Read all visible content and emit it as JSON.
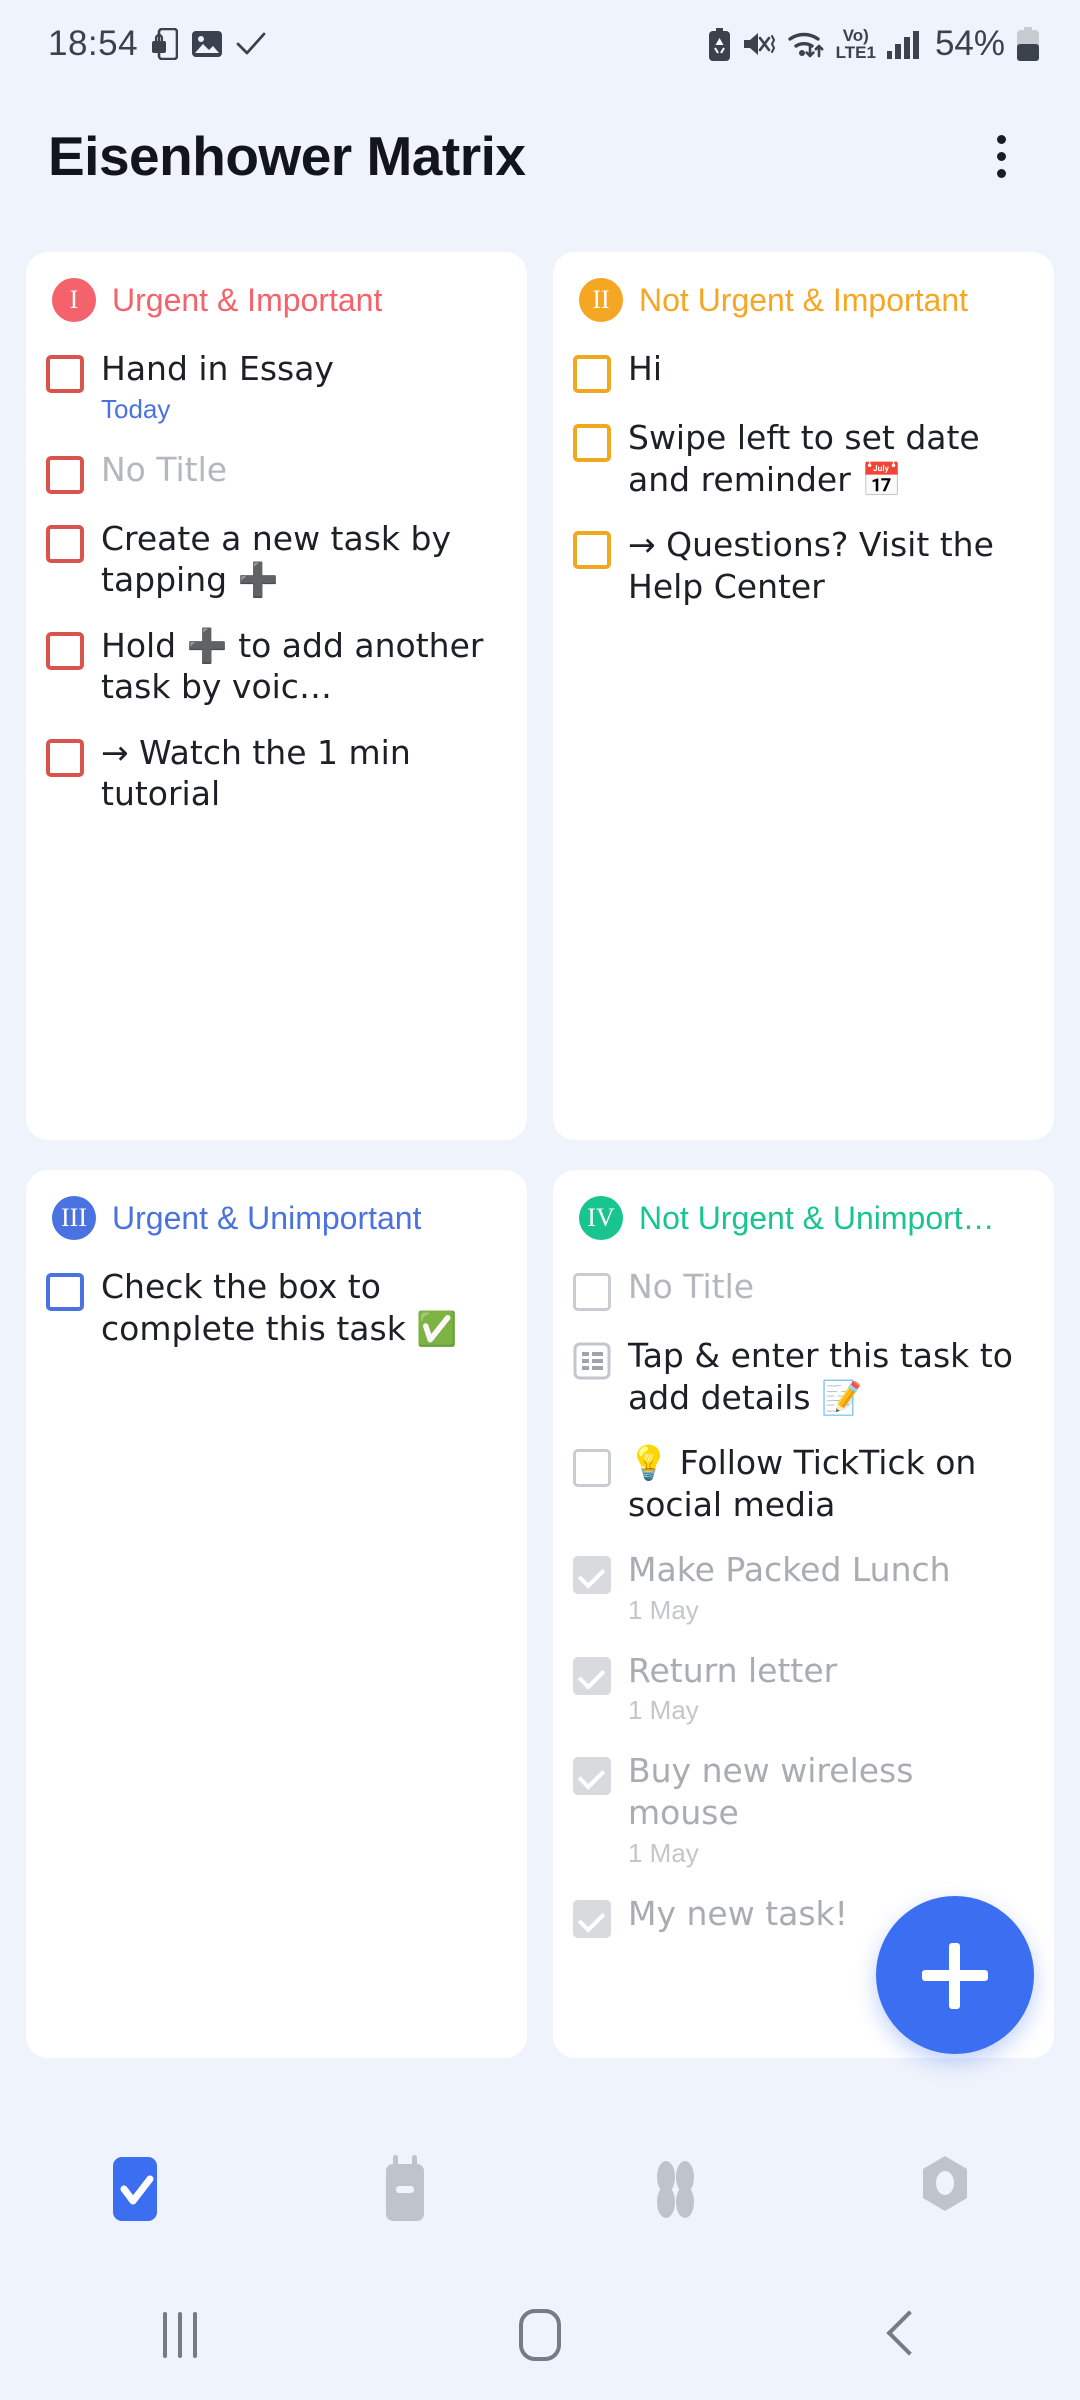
{
  "statusbar": {
    "time": "18:54",
    "battery_percent": "54%",
    "left_icons": [
      "sim-lock-icon",
      "photo-icon",
      "check-icon"
    ],
    "right_icons": [
      "battery-saver-icon",
      "mute-vibrate-icon",
      "wifi-icon",
      "volte-lte1-icon",
      "signal-bars-icon"
    ],
    "network_label_top": "Vo)",
    "network_label_bottom": "LTE1"
  },
  "header": {
    "title": "Eisenhower Matrix",
    "overflow_menu": "more-options"
  },
  "colors": {
    "background": "#eff3fb",
    "card": "#ffffff",
    "q1": "#f4626b",
    "q2": "#f5a623",
    "q3": "#4a72e0",
    "q4": "#18c58e",
    "accent": "#3b6ef0",
    "date_blue": "#4a72e0",
    "muted": "#b4b7bd"
  },
  "quadrants": [
    {
      "roman": "I",
      "title": "Urgent & Important",
      "color": "#f4626b",
      "box_style": "red",
      "tasks": [
        {
          "text": "Hand in Essay",
          "date": "Today",
          "date_style": "blue",
          "state": "open",
          "box": "red"
        },
        {
          "text": "No Title",
          "state": "placeholder",
          "box": "red"
        },
        {
          "text": "Create a new task by tapping ➕",
          "state": "open",
          "box": "red"
        },
        {
          "text": "Hold ➕ to add another task by voic…",
          "state": "open",
          "box": "red"
        },
        {
          "text": "→  Watch the 1 min tutorial",
          "state": "open",
          "box": "red"
        }
      ]
    },
    {
      "roman": "II",
      "title": "Not Urgent & Important",
      "color": "#f5a623",
      "box_style": "amber",
      "tasks": [
        {
          "text": "Hi",
          "state": "open",
          "box": "amber"
        },
        {
          "text": "Swipe left to set date and reminder 📅",
          "state": "open",
          "box": "amber"
        },
        {
          "text": "→  Questions? Visit the Help Center",
          "state": "open",
          "box": "amber"
        }
      ]
    },
    {
      "roman": "III",
      "title": "Urgent & Unimportant",
      "color": "#4a72e0",
      "box_style": "blue",
      "tasks": [
        {
          "text": "Check the box to complete this task ✅",
          "state": "open",
          "box": "blue"
        }
      ]
    },
    {
      "roman": "IV",
      "title": "Not Urgent & Unimport…",
      "color": "#18c58e",
      "box_style": "grey",
      "tasks": [
        {
          "text": "No Title",
          "state": "placeholder",
          "box": "grey"
        },
        {
          "text": "Tap & enter this task to add details 📝",
          "state": "open",
          "box": "list"
        },
        {
          "text": "💡  Follow TickTick on social media",
          "state": "open",
          "box": "grey"
        },
        {
          "text": "Make Packed Lunch",
          "date": "1 May",
          "date_style": "grey",
          "state": "done",
          "box": "done"
        },
        {
          "text": "Return letter",
          "date": "1 May",
          "date_style": "grey",
          "state": "done",
          "box": "done"
        },
        {
          "text": "Buy new wireless mouse",
          "date": "1 May",
          "date_style": "grey",
          "state": "done",
          "box": "done"
        },
        {
          "text": "My new task!",
          "state": "done",
          "box": "done"
        }
      ]
    }
  ],
  "fab": {
    "label": "add-task",
    "icon": "plus-icon"
  },
  "tabbar": {
    "items": [
      {
        "name": "tasks",
        "icon": "checkbox-tick-icon",
        "active": true
      },
      {
        "name": "calendar",
        "icon": "calendar-icon",
        "active": false
      },
      {
        "name": "matrix",
        "icon": "four-quadrants-icon",
        "active": false
      },
      {
        "name": "settings",
        "icon": "gear-icon",
        "active": false
      }
    ]
  },
  "androidnav": {
    "recents": "recents-icon",
    "home": "home-icon",
    "back": "back-icon"
  }
}
